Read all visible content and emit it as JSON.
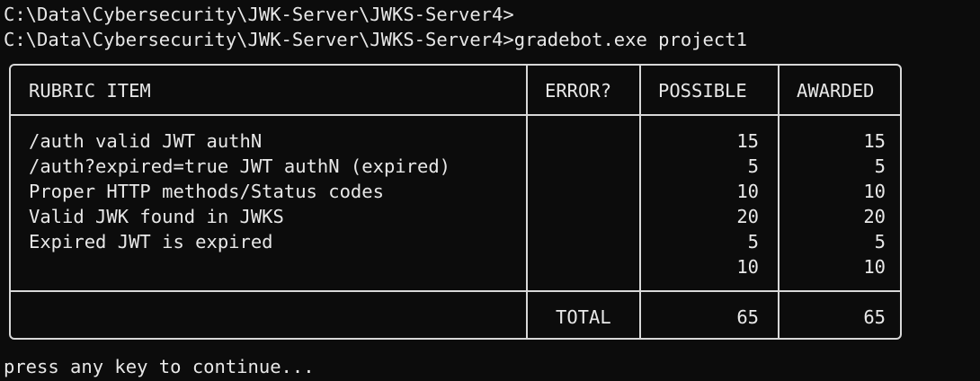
{
  "console": {
    "line1": "C:\\Data\\Cybersecurity\\JWK-Server\\JWKS-Server4>",
    "line2": "C:\\Data\\Cybersecurity\\JWK-Server\\JWKS-Server4>gradebot.exe project1",
    "footer": "press any key to continue..."
  },
  "table": {
    "headers": {
      "item": "RUBRIC ITEM",
      "error": "ERROR?",
      "possible": "POSSIBLE",
      "awarded": "AWARDED"
    },
    "rows": [
      {
        "item": "/auth valid JWT authN",
        "error": "",
        "possible": "15",
        "awarded": "15"
      },
      {
        "item": "/auth?expired=true JWT authN (expired)",
        "error": "",
        "possible": "5",
        "awarded": "5"
      },
      {
        "item": "Proper HTTP methods/Status codes",
        "error": "",
        "possible": "10",
        "awarded": "10"
      },
      {
        "item": "Valid JWK found in JWKS",
        "error": "",
        "possible": "20",
        "awarded": "20"
      },
      {
        "item": "Expired JWT is expired",
        "error": "",
        "possible": "5",
        "awarded": "5"
      },
      {
        "item": "",
        "error": "",
        "possible": "10",
        "awarded": "10"
      }
    ],
    "total": {
      "label": "TOTAL",
      "possible": "65",
      "awarded": "65"
    }
  },
  "colors": {
    "background": "#0c0c0c",
    "text": "#e8e8e8",
    "border": "#d8d8d8"
  }
}
